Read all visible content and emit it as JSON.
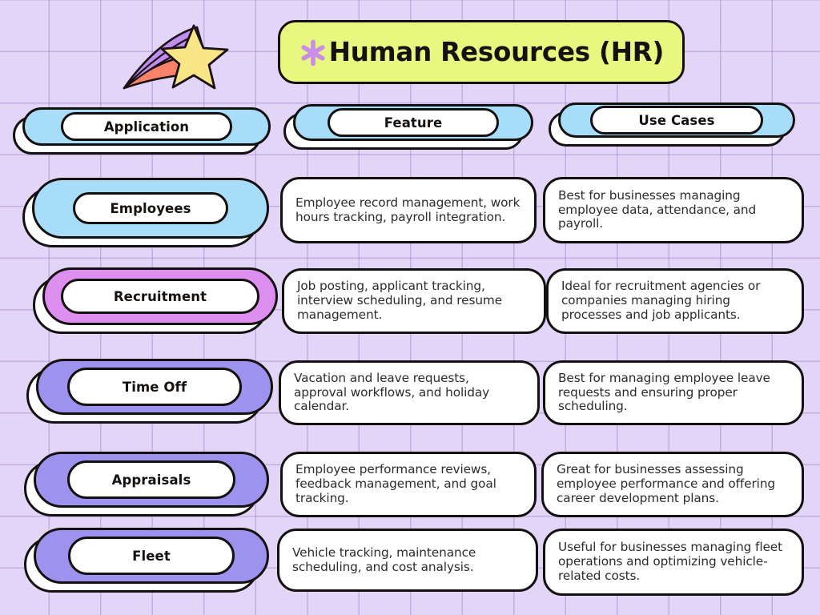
{
  "header": {
    "title": "Human Resources (HR)",
    "title_icon": "sparkle-asterisk-icon",
    "decoration_icon": "shooting-star-icon"
  },
  "colors": {
    "background": "#e3d5f8",
    "grid_line": "#9678c3",
    "title_card": "#e8f77f",
    "sparkle": "#c98fe8",
    "outline": "#13100f",
    "header_pill": "#a7ddf8",
    "card": "#ffffff",
    "star_body": "#f8e585",
    "star_trail_purple": "#c18ef0",
    "star_trail_coral": "#f88368"
  },
  "columns": [
    {
      "label": "Application",
      "color": "#a7ddf8"
    },
    {
      "label": "Feature",
      "color": "#a7ddf8"
    },
    {
      "label": "Use Cases",
      "color": "#a7ddf8"
    }
  ],
  "rows": [
    {
      "application": "Employees",
      "color": "#a7ddf8",
      "feature": "Employee record management, work hours tracking, payroll integration.",
      "use_case": "Best for businesses managing employee data, attendance, and payroll."
    },
    {
      "application": "Recruitment",
      "color": "#dd8ff0",
      "feature": "Job posting, applicant tracking, interview scheduling, and resume management.",
      "use_case": "Ideal for recruitment agencies or companies managing hiring processes and job applicants."
    },
    {
      "application": "Time Off",
      "color": "#9d92ee",
      "feature": "Vacation and leave requests, approval workflows, and holiday calendar.",
      "use_case": "Best for managing employee leave requests and ensuring proper scheduling."
    },
    {
      "application": "Appraisals",
      "color": "#9d92ee",
      "feature": "Employee performance reviews, feedback management, and goal tracking.",
      "use_case": "Great for businesses assessing employee performance and offering career development plans."
    },
    {
      "application": "Fleet",
      "color": "#9d92ee",
      "feature": "Vehicle tracking, maintenance scheduling, and cost analysis.",
      "use_case": "Useful for businesses managing fleet operations and optimizing vehicle-related costs."
    }
  ]
}
